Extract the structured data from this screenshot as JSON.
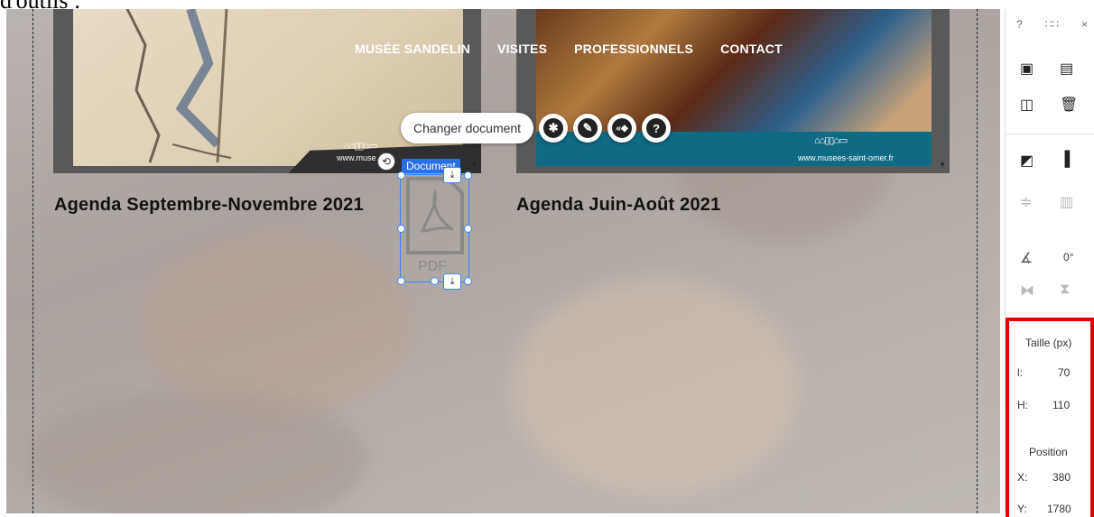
{
  "top_text": "d'outils :",
  "nav": [
    "MUSÉE SANDELIN",
    "VISITES",
    "PROFESSIONNELS",
    "CONTACT"
  ],
  "cards": [
    {
      "title": "Agenda Septembre-Novembre 2021",
      "url": "www.muse"
    },
    {
      "title": "Agenda Juin-Août 2021",
      "url": "www.musees-saint-omer.fr"
    }
  ],
  "toolbar": {
    "change_document": "Changer document",
    "icons": [
      "gear-icon",
      "pen-icon",
      "animation-icon",
      "help-icon"
    ]
  },
  "selected": {
    "tag": "Document",
    "pdf_label": "PDF"
  },
  "panel": {
    "help": "?",
    "drag": "∷∷",
    "close": "×",
    "rotation_value": "0°",
    "size_header": "Taille (px)",
    "width_label": "l:",
    "width_value": "70",
    "height_label": "H:",
    "height_value": "110",
    "position_header": "Position",
    "x_label": "X:",
    "x_value": "380",
    "y_label": "Y:",
    "y_value": "1780"
  },
  "colors": {
    "highlight": "#e00000",
    "selection": "#3b82f6",
    "tag": "#2b6fe8"
  }
}
